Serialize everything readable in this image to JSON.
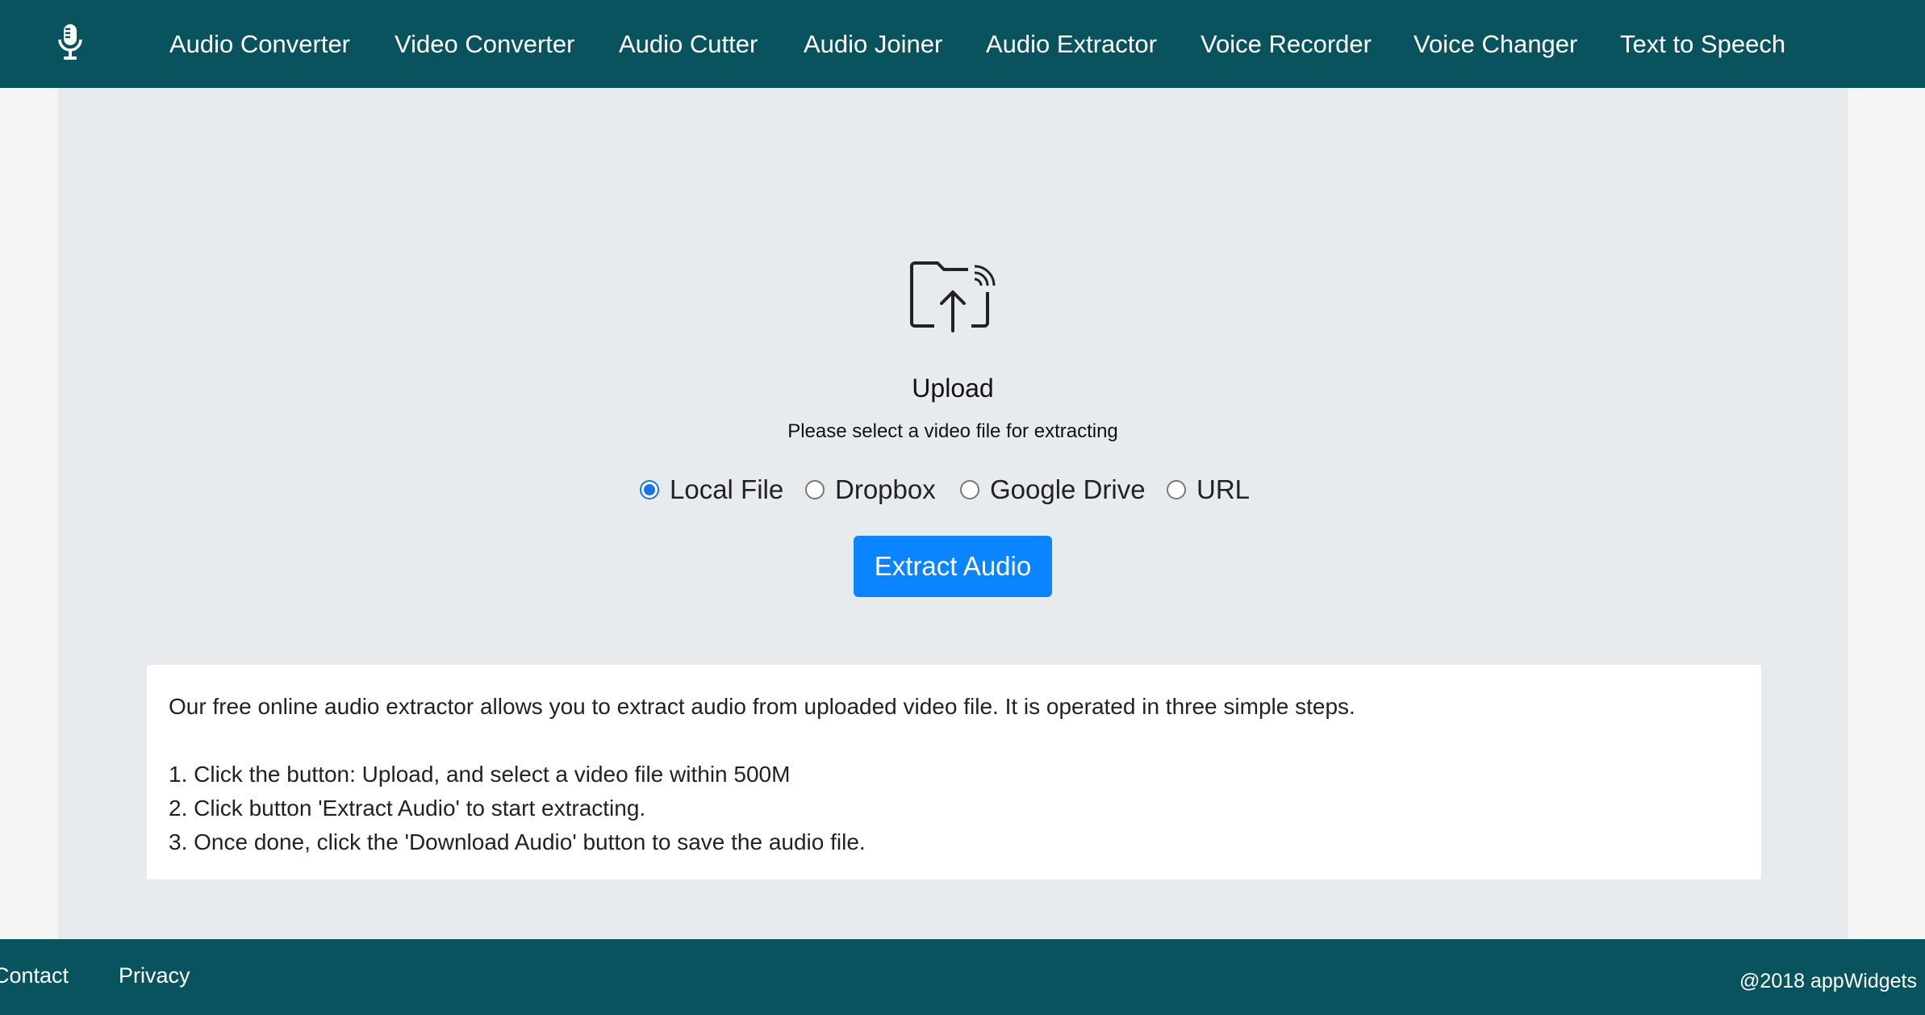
{
  "navbar": {
    "logo_icon": "microphone-icon",
    "items": [
      {
        "label": "Audio Converter"
      },
      {
        "label": "Video Converter"
      },
      {
        "label": "Audio Cutter"
      },
      {
        "label": "Audio Joiner"
      },
      {
        "label": "Audio Extractor"
      },
      {
        "label": "Voice Recorder"
      },
      {
        "label": "Voice Changer"
      },
      {
        "label": "Text to Speech"
      }
    ]
  },
  "upload": {
    "icon": "folder-upload-icon",
    "title": "Upload",
    "subtitle": "Please select a video file for extracting",
    "sources": [
      {
        "label": "Local File",
        "checked": true
      },
      {
        "label": "Dropbox",
        "checked": false
      },
      {
        "label": "Google Drive",
        "checked": false
      },
      {
        "label": "URL",
        "checked": false
      }
    ],
    "button_label": "Extract Audio"
  },
  "info": {
    "intro": "Our free online audio extractor allows you to extract audio from uploaded video file. It is operated in three simple steps.",
    "steps": [
      "1. Click the button: Upload, and select a video file within 500M",
      "2. Click button 'Extract Audio' to start extracting.",
      "3. Once done, click the 'Download Audio' button to save the audio file."
    ]
  },
  "footer": {
    "links": [
      {
        "label": "Contact"
      },
      {
        "label": "Privacy"
      }
    ],
    "copyright": "@2018 appWidgets"
  },
  "colors": {
    "nav_bg": "#09535f",
    "panel_bg": "#e8ebee",
    "accent": "#0a84ff",
    "radio_checked": "#1a73e8"
  }
}
